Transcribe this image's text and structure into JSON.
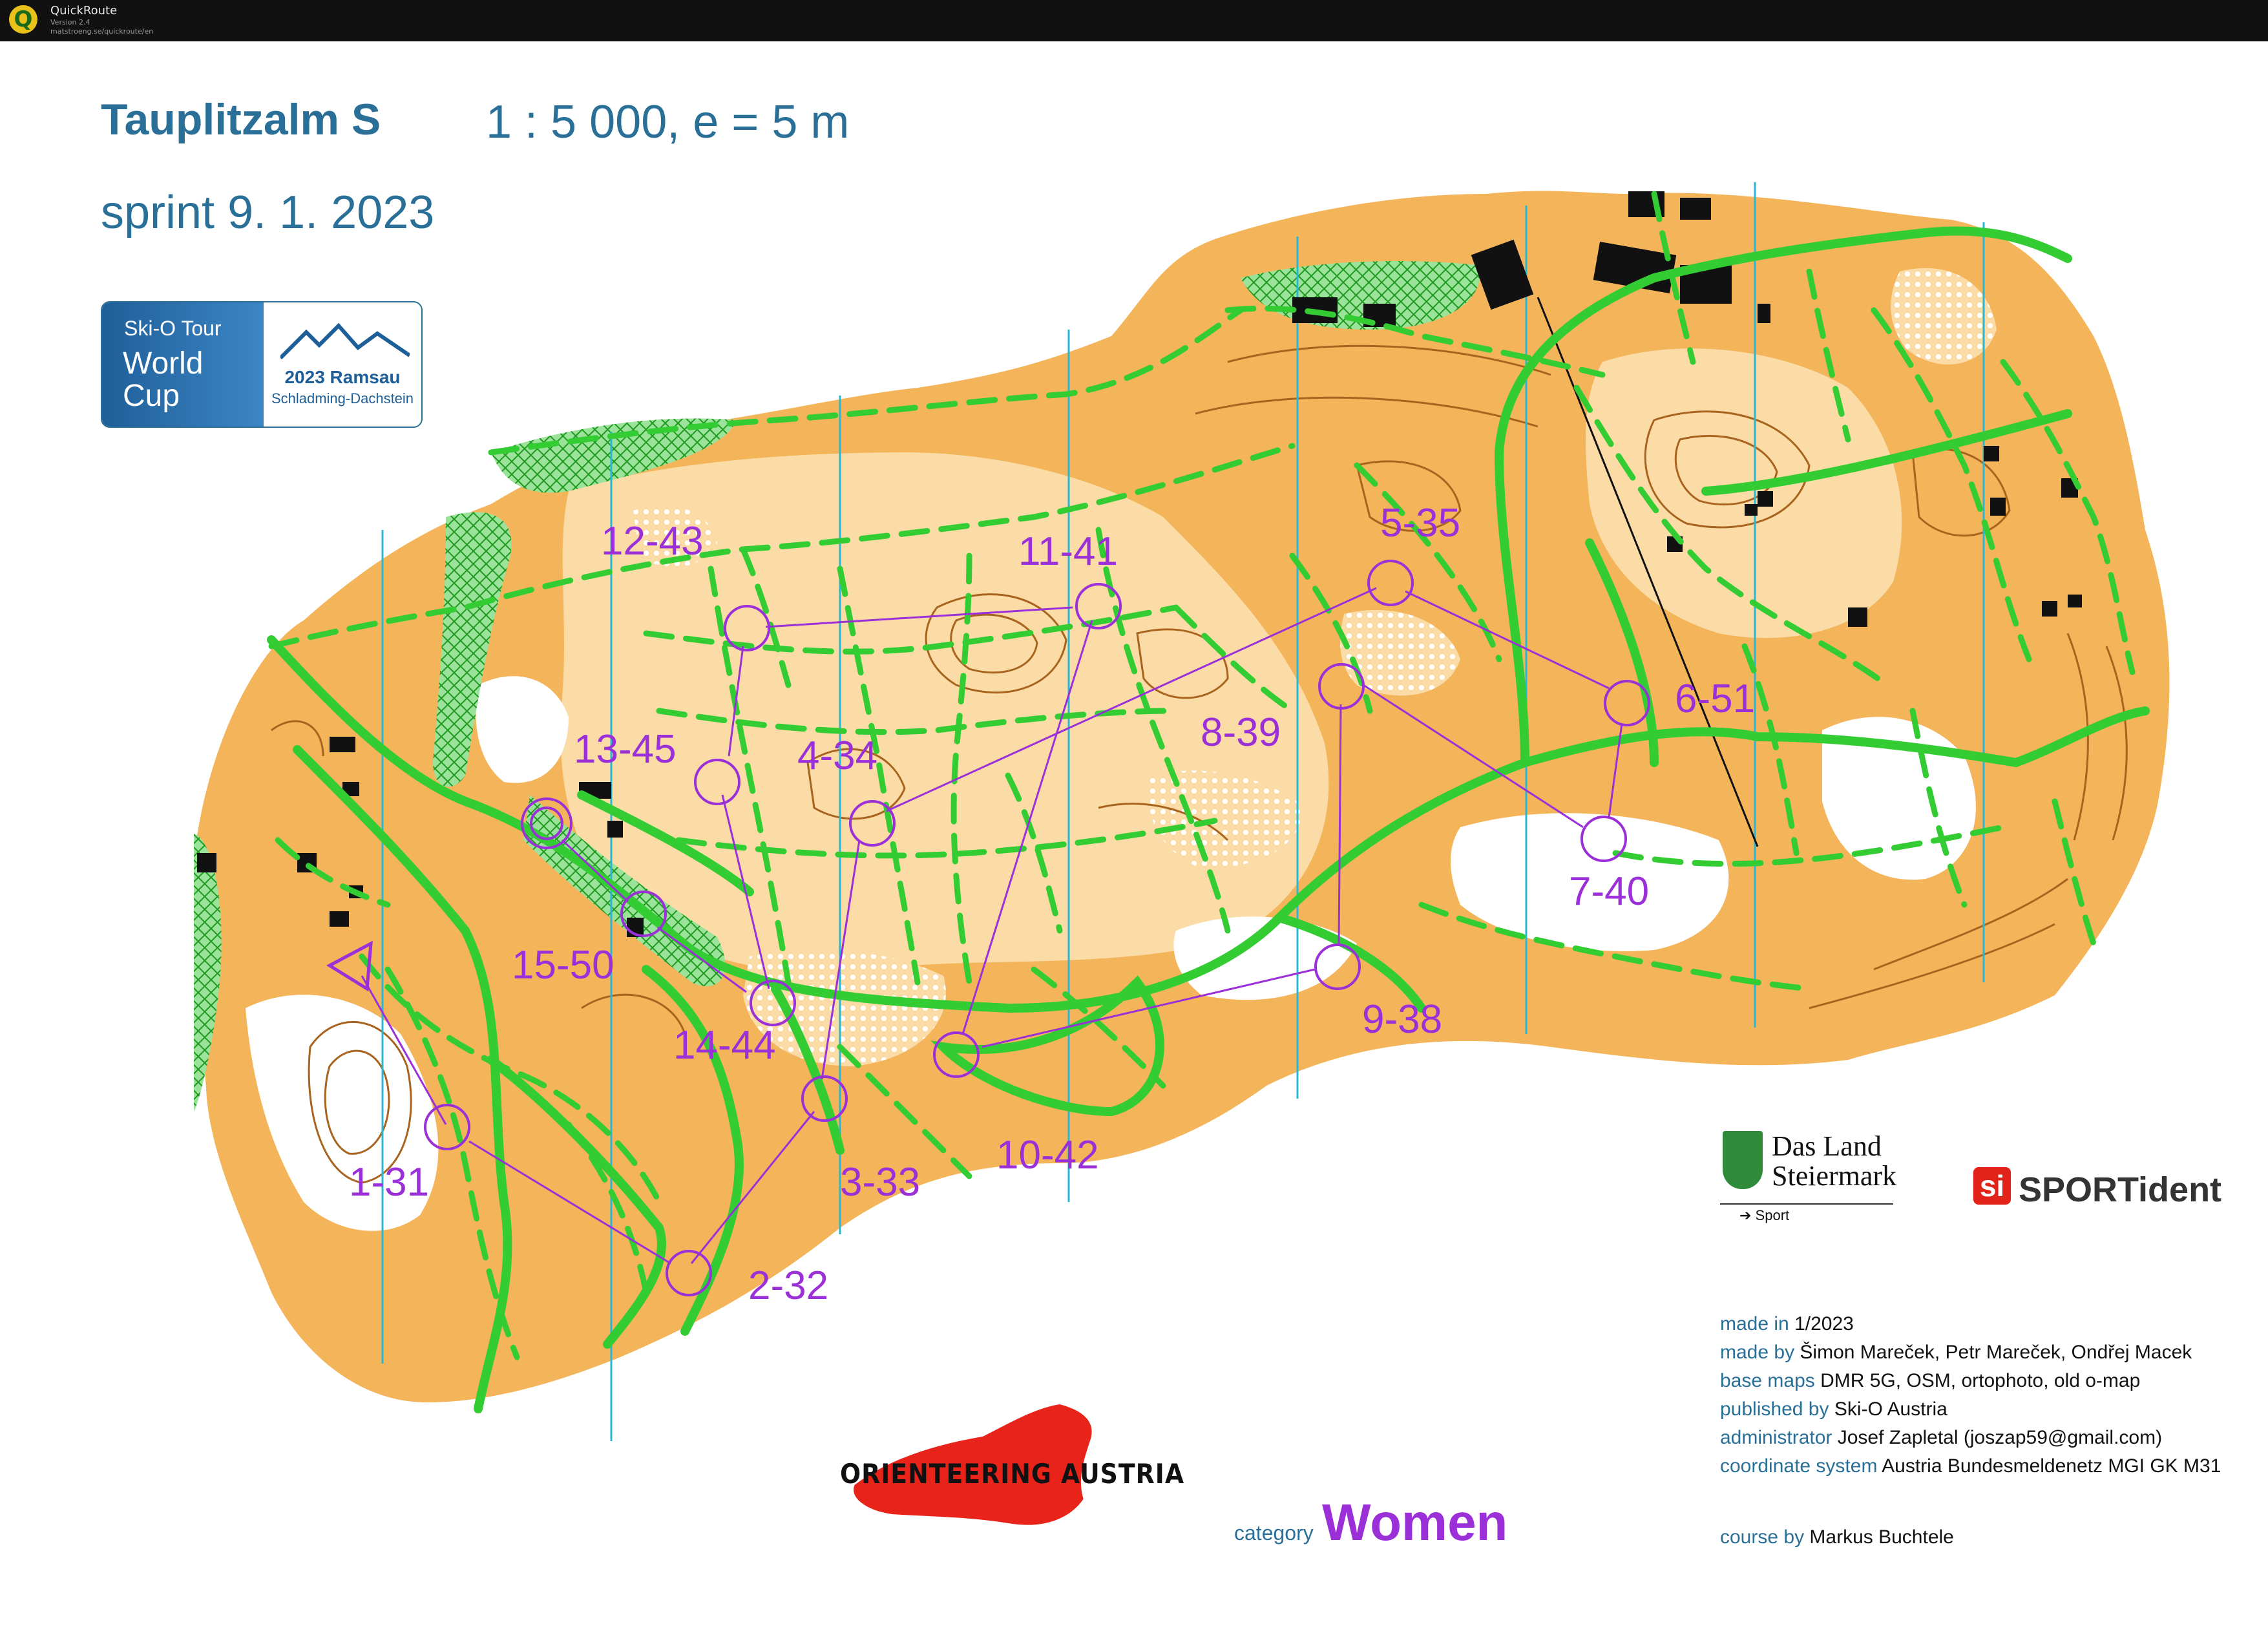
{
  "window": {
    "app_name": "QuickRoute",
    "app_version": "Version 2.4",
    "app_url": "matstroeng.se/quickroute/en",
    "logo_glyph": "Q"
  },
  "header": {
    "title": "Tauplitzalm S",
    "scale": "1 : 5 000, e = 5 m",
    "subtitle": "sprint 9. 1. 2023"
  },
  "badge": {
    "tour": "Ski-O Tour",
    "world": "World",
    "cup": "Cup",
    "year_place": "2023 Ramsau",
    "region": "Schladming-Dachstein"
  },
  "course": {
    "category_label": "category",
    "category_value": "Women",
    "controls": [
      {
        "label": "1-31"
      },
      {
        "label": "2-32"
      },
      {
        "label": "3-33"
      },
      {
        "label": "4-34"
      },
      {
        "label": "5-35"
      },
      {
        "label": "6-51"
      },
      {
        "label": "7-40"
      },
      {
        "label": "8-39"
      },
      {
        "label": "9-38"
      },
      {
        "label": "10-42"
      },
      {
        "label": "11-41"
      },
      {
        "label": "12-43"
      },
      {
        "label": "13-45"
      },
      {
        "label": "14-44"
      },
      {
        "label": "15-50"
      }
    ]
  },
  "sponsors": {
    "steiermark_line1": "Das Land",
    "steiermark_line2": "Steiermark",
    "steiermark_sub": "➔ Sport",
    "sportident_mark": "si",
    "sportident_text": "SPORTident",
    "orienteering_austria": "ORIENTEERING AUSTRIA"
  },
  "credits": [
    {
      "key": "made in",
      "value": "1/2023"
    },
    {
      "key": "made by",
      "value": "Šimon Mareček, Petr Mareček, Ondřej Macek"
    },
    {
      "key": "base maps",
      "value": "DMR 5G, OSM, ortophoto, old o-map"
    },
    {
      "key": "published by",
      "value": "Ski-O Austria"
    },
    {
      "key": "administrator",
      "value": "Josef Zapletal (joszap59@gmail.com)"
    },
    {
      "key": "coordinate system",
      "value": "Austria Bundesmeldenetz MGI GK M31"
    }
  ],
  "course_by": {
    "key": "course by",
    "value": "Markus Buchtele"
  },
  "colors": {
    "map_orange": "#f3b45a",
    "map_light": "#fbdca6",
    "trail_green": "#33cc33",
    "course_purple": "#9b30d9",
    "north_line": "#29b8d4",
    "contour_brown": "#a8641e",
    "heading_blue": "#2a6f97"
  }
}
